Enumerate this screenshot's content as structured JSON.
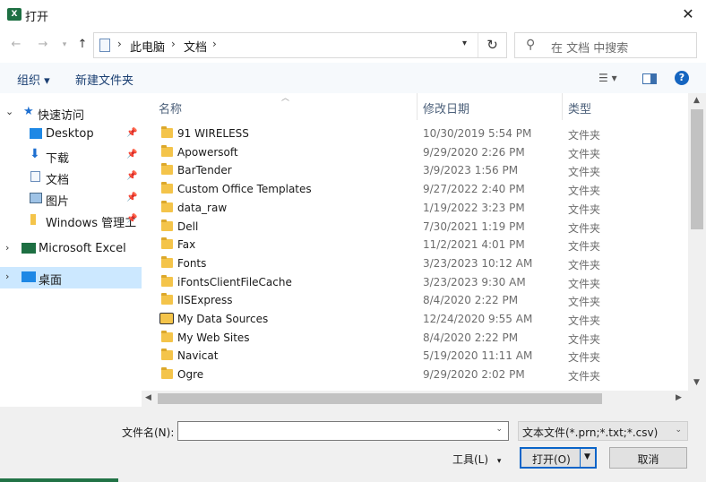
{
  "window": {
    "title": "打开",
    "app_icon_text": "X"
  },
  "navbar": {
    "breadcrumbs": [
      "此电脑",
      "文档"
    ],
    "search_placeholder": "在 文档 中搜索"
  },
  "toolbar": {
    "organize": "组织 ▾",
    "new_folder": "新建文件夹"
  },
  "sidebar": {
    "items": [
      {
        "label": "快速访问",
        "icon": "star-icon"
      },
      {
        "label": "Desktop",
        "icon": "desktop-icon"
      },
      {
        "label": "下载",
        "icon": "download-icon"
      },
      {
        "label": "文档",
        "icon": "document-icon"
      },
      {
        "label": "图片",
        "icon": "pictures-icon"
      },
      {
        "label": "Windows 管理工",
        "icon": "folder-icon"
      },
      {
        "label": "Microsoft Excel",
        "icon": "excel-icon"
      },
      {
        "label": "桌面",
        "icon": "desktop-icon"
      }
    ]
  },
  "columns": {
    "name": "名称",
    "date": "修改日期",
    "type": "类型"
  },
  "files": [
    {
      "name": "91 WIRELESS",
      "date": "10/30/2019 5:54 PM",
      "type": "文件夹"
    },
    {
      "name": "Apowersoft",
      "date": "9/29/2020 2:26 PM",
      "type": "文件夹"
    },
    {
      "name": "BarTender",
      "date": "3/9/2023 1:56 PM",
      "type": "文件夹"
    },
    {
      "name": "Custom Office Templates",
      "date": "9/27/2022 2:40 PM",
      "type": "文件夹"
    },
    {
      "name": "data_raw",
      "date": "1/19/2022 3:23 PM",
      "type": "文件夹"
    },
    {
      "name": "Dell",
      "date": "7/30/2021 1:19 PM",
      "type": "文件夹"
    },
    {
      "name": "Fax",
      "date": "11/2/2021 4:01 PM",
      "type": "文件夹"
    },
    {
      "name": "Fonts",
      "date": "3/23/2023 10:12 AM",
      "type": "文件夹"
    },
    {
      "name": "iFontsClientFileCache",
      "date": "3/23/2023 9:30 AM",
      "type": "文件夹"
    },
    {
      "name": "IISExpress",
      "date": "8/4/2020 2:22 PM",
      "type": "文件夹"
    },
    {
      "name": "My Data Sources",
      "date": "12/24/2020 9:55 AM",
      "type": "文件夹"
    },
    {
      "name": "My Web Sites",
      "date": "8/4/2020 2:22 PM",
      "type": "文件夹"
    },
    {
      "name": "Navicat",
      "date": "5/19/2020 11:11 AM",
      "type": "文件夹"
    },
    {
      "name": "Ogre",
      "date": "9/29/2020 2:02 PM",
      "type": "文件夹"
    }
  ],
  "bottom": {
    "filename_label": "文件名(N):",
    "filename_value": "",
    "filter": "文本文件(*.prn;*.txt;*.csv)",
    "tools": "工具(L)",
    "open": "打开(O)",
    "cancel": "取消"
  }
}
